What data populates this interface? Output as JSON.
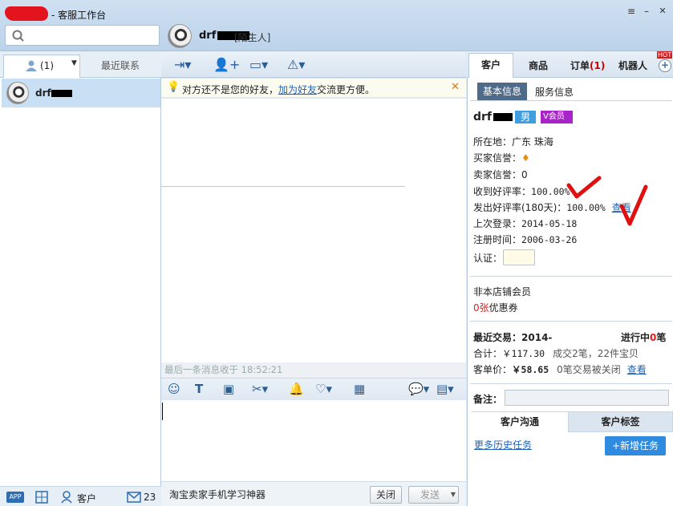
{
  "window": {
    "title": "- 客服工作台"
  },
  "chat_header": {
    "name": "drf",
    "relation": "[陌生人]"
  },
  "left_tabs": {
    "tab1": "(1)",
    "tab2": "最近联系"
  },
  "contacts": [
    {
      "name": "drf"
    }
  ],
  "left_footer": {
    "app": "APP",
    "customer": "客户",
    "mail_count": "23"
  },
  "notice": {
    "prefix": "对方还不是您的好友，",
    "link": "加为好友",
    "suffix": "交流更方便。"
  },
  "chat": {
    "last_message": "最后一条消息收于 18:52:21"
  },
  "bottom": {
    "promo": "淘宝卖家手机学习神器",
    "close": "关闭",
    "send": "发送"
  },
  "right_tabs": {
    "customer": "客户",
    "product": "商品",
    "order": "订单",
    "order_count": "(1)",
    "robot": "机器人",
    "hot": "HOT"
  },
  "sub_tabs": {
    "basic": "基本信息",
    "service": "服务信息"
  },
  "customer": {
    "name": "drf",
    "gender": "男",
    "vip": "会员",
    "location_label": "所在地：",
    "location": "广东 珠海",
    "buyer_credit_label": "买家信誉：",
    "seller_credit_label": "卖家信誉：",
    "seller_credit": "0",
    "received_rate_label": "收到好评率：",
    "received_rate": "100.00%",
    "given_rate_label": "发出好评率(180天)：",
    "given_rate": "100.00%",
    "view_link": "查看",
    "last_login_label": "上次登录：",
    "last_login": "2014-05-18",
    "register_label": "注册时间：",
    "register": "2006-03-26",
    "auth_label": "认证："
  },
  "membership": {
    "status": "非本店铺会员",
    "coupon_count": "0张",
    "coupon_label": "优惠券"
  },
  "trade": {
    "recent_label": "最近交易：",
    "recent_value": "2014-",
    "ongoing_label": "进行中",
    "ongoing_count": "0",
    "ongoing_unit": "笔",
    "total_label": "合计：",
    "total": "￥117.30",
    "deals": "成交2笔，22件宝贝",
    "unit_price_label": "客单价：",
    "unit_price": "￥58.65",
    "closed": "0笔交易被关闭",
    "view_link": "查看"
  },
  "note": {
    "label": "备注："
  },
  "bottom_tabs": {
    "comm": "客户沟通",
    "tags": "客户标签"
  },
  "tasks": {
    "history": "更多历史任务",
    "add": "+新增任务"
  },
  "colors": {
    "accent": "#4e6c8a",
    "link": "#1f63b8",
    "mask": "#e3141d"
  }
}
